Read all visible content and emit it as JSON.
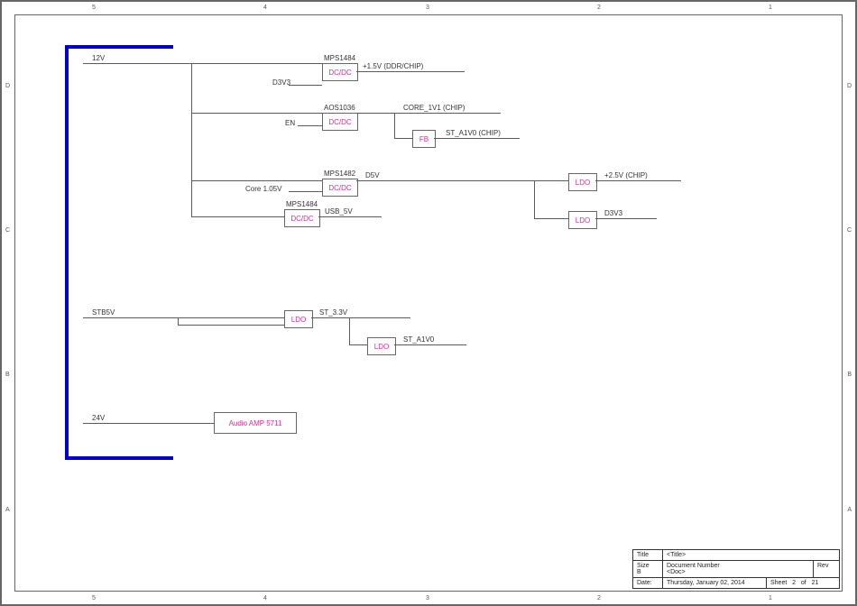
{
  "rails": {
    "in1": "12V",
    "in2": "STB5V",
    "in3": "24V"
  },
  "ic": {
    "mps1484a": "MPS1484",
    "aos1036": "AOS1036",
    "mps1482": "MPS1482",
    "mps1484b": "MPS1484"
  },
  "blk": {
    "dcdc": "DC/DC",
    "fb": "FB",
    "ldo": "LDO",
    "audio": "Audio AMP 5711"
  },
  "net": {
    "d3v3_a": "D3V3",
    "p1v5": "+1.5V  (DDR/CHIP)",
    "en": "EN",
    "core1v1": "CORE_1V1 (CHIP)",
    "sta1v0": "ST_A1V0 (CHIP)",
    "core105": "Core 1.05V",
    "d5v": "D5V",
    "p2v5": "+2.5V  (CHIP)",
    "usb5v": "USB_5V",
    "d3v3_b": "D3V3",
    "st33v": "ST_3.3V",
    "sta1v0b": "ST_A1V0"
  },
  "zones": {
    "top": [
      "5",
      "4",
      "3",
      "2",
      "1"
    ],
    "bottom": [
      "5",
      "4",
      "3",
      "2",
      "1"
    ],
    "left": [
      "D",
      "C",
      "B",
      "A"
    ],
    "right": [
      "D",
      "C",
      "B",
      "A"
    ]
  },
  "titleblock": {
    "title_k": "Title",
    "title_v": "<Title>",
    "size_k": "Size",
    "size_v": "B",
    "docnum_k": "Document Number",
    "docnum_v": "<Doc>",
    "rev_k": "Rev",
    "date_k": "Date:",
    "date_v": "Thursday, January 02, 2014",
    "sheet_k": "Sheet",
    "sheet_n": "2",
    "of": "of",
    "sheet_t": "21"
  }
}
